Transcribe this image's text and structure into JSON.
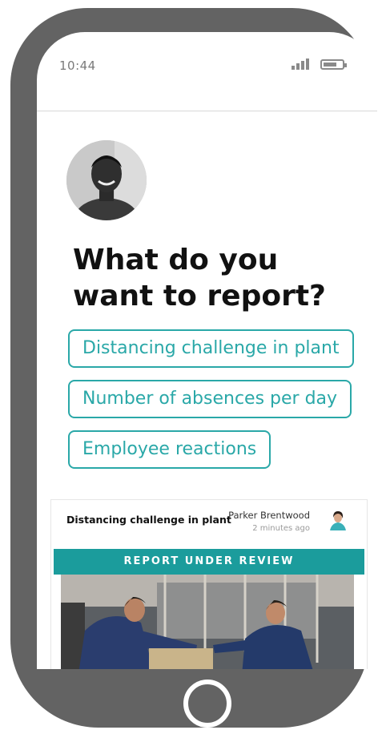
{
  "status_bar": {
    "time": "10:44",
    "signal_icon": "signal-bars-icon",
    "battery_icon": "battery-icon"
  },
  "main": {
    "heading": "What do you want to report?",
    "options": [
      {
        "label": "Distancing challenge in plant"
      },
      {
        "label": "Number of absences per day"
      },
      {
        "label": "Employee reactions"
      }
    ]
  },
  "report_card": {
    "title": "Distancing challenge in plant",
    "author": "Parker Brentwood",
    "time_ago": "2 minutes ago",
    "status_banner": "REPORT UNDER REVIEW"
  },
  "colors": {
    "accent": "#2aa8a8",
    "banner": "#1b9c9c",
    "phone_body": "#636363"
  }
}
